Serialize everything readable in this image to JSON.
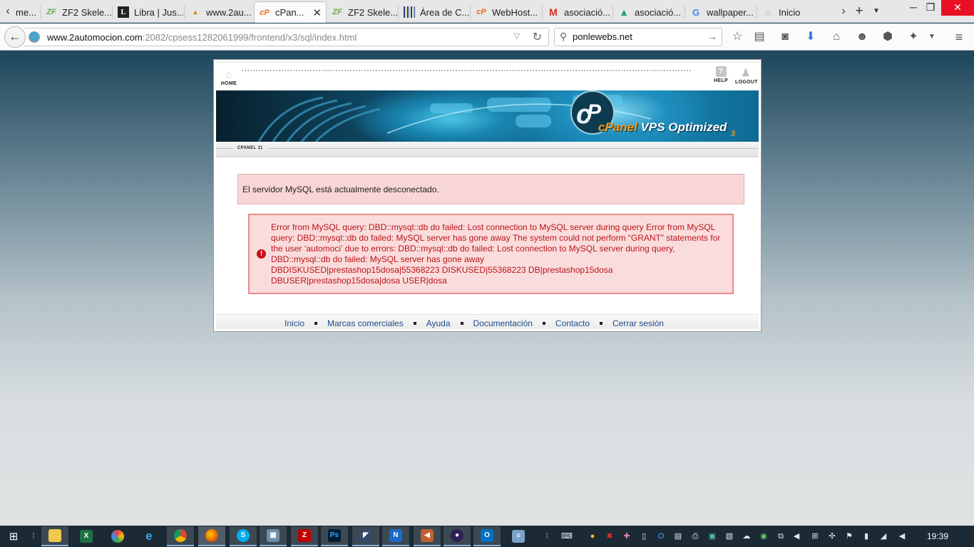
{
  "browser": {
    "tabs": [
      {
        "label": "me...",
        "icon": "page-icon"
      },
      {
        "label": "ZF2 Skele...",
        "icon": "zf-icon"
      },
      {
        "label": "Libra | Jus...",
        "icon": "libra-icon"
      },
      {
        "label": "www.2au...",
        "icon": "pma-icon"
      },
      {
        "label": "cPan...",
        "icon": "cpanel-icon",
        "active": true
      },
      {
        "label": "ZF2 Skele...",
        "icon": "zf-icon"
      },
      {
        "label": "Área de C...",
        "icon": "barcode-icon"
      },
      {
        "label": "WebHost...",
        "icon": "cpanel-icon"
      },
      {
        "label": "asociació...",
        "icon": "gmail-icon"
      },
      {
        "label": "asociació...",
        "icon": "drive-icon"
      },
      {
        "label": "wallpaper...",
        "icon": "google-icon"
      },
      {
        "label": "Inicio",
        "icon": "loading-icon"
      }
    ],
    "url_host": "www.2automocion.com",
    "url_rest": ":2082/cpsess1282061999/frontend/x3/sql/index.html",
    "search_value": "ponlewebs.net"
  },
  "cpanel": {
    "top_home": "HOME",
    "top_help": "HELP",
    "top_logout": "LOGOUT",
    "logo_c": "cPanel",
    "logo_rest": " VPS Optimized",
    "logo_version": "3",
    "section_label": "CPANEL 11",
    "warning": "El servidor MySQL está actualmente desconectado.",
    "error": "Error from MySQL query: DBD::mysql::db do failed: Lost connection to MySQL server during query Error from MySQL query: DBD::mysql::db do failed: MySQL server has gone away The system could not perform “GRANT” statements for the user ‘automoci’ due to errors: DBD::mysql::db do failed: Lost connection to MySQL server during query, DBD::mysql::db do failed: MySQL server has gone away\nDBDISKUSED|prestashop15dosa|55368223 DISKUSED|55368223 DB|prestashop15dosa\nDBUSER|prestashop15dosa|dosa USER|dosa",
    "footer_links": [
      "Inicio",
      "Marcas comerciales",
      "Ayuda",
      "Documentación",
      "Contacto",
      "Cerrar sesión"
    ]
  },
  "taskbar": {
    "clock": "19:39"
  },
  "colors": {
    "warning_bg": "#f9d6d6",
    "error_bg": "#fbdcdc",
    "error_border": "#ee8a8a",
    "error_text": "#b9161b",
    "link": "#1c4b8a"
  }
}
